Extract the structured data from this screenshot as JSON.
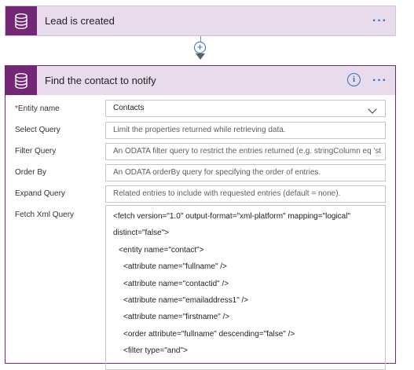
{
  "trigger": {
    "title": "Lead is created",
    "more": "···"
  },
  "connector": {
    "add": "+"
  },
  "action": {
    "title": "Find the contact to notify",
    "info": "i",
    "more": "···",
    "fields": [
      {
        "label": "Entity name",
        "required": "*",
        "value": "Contacts",
        "placeholder": ""
      },
      {
        "label": "Select Query",
        "value": "",
        "placeholder": "Limit the properties returned while retrieving data."
      },
      {
        "label": "Filter Query",
        "value": "",
        "placeholder": "An ODATA filter query to restrict the entries returned (e.g. stringColumn eq 'st"
      },
      {
        "label": "Order By",
        "value": "",
        "placeholder": "An ODATA orderBy query for specifying the order of entries."
      },
      {
        "label": "Expand Query",
        "value": "",
        "placeholder": "Related entries to include with requested entries (default = none)."
      }
    ],
    "fetch_xml": {
      "label": "Fetch Xml Query",
      "lines": [
        "<fetch version=\"1.0\" output-format=\"xml-platform\" mapping=\"logical\"",
        "distinct=\"false\">",
        "  <entity name=\"contact\">",
        "    <attribute name=\"fullname\" />",
        "    <attribute name=\"contactid\" />",
        "    <attribute name=\"emailaddress1\" />",
        "    <attribute name=\"firstname\" />",
        "    <order attribute=\"fullname\" descending=\"false\" />",
        "    <filter type=\"and\">"
      ]
    }
  }
}
